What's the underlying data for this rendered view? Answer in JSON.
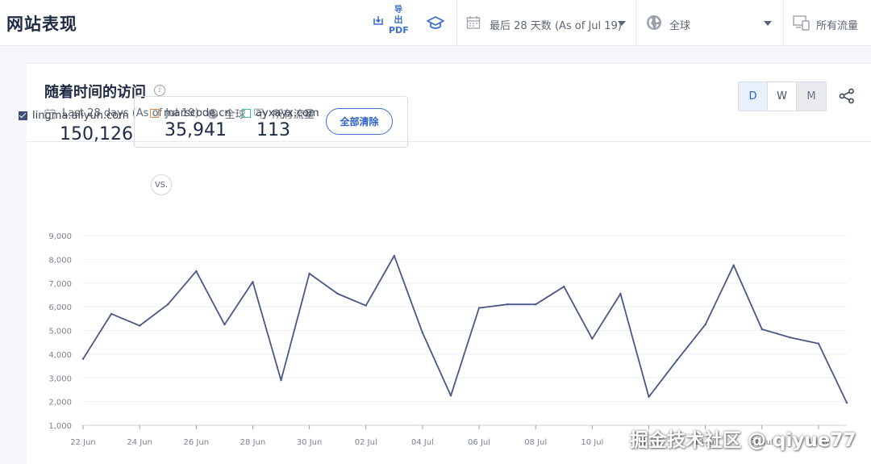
{
  "header": {
    "title": "网站表现",
    "export_label_1": "导",
    "export_label_2": "出",
    "export_label_3": "PDF",
    "date_range": "最后 28 天数 (As of Jul 19)",
    "region": "全球",
    "traffic": "所有流量"
  },
  "card": {
    "title": "随着时间的访问",
    "info": "i",
    "sub_date": "Last 28 days (As of Jul 19)",
    "sub_region": "全球",
    "sub_traffic": "所有流量",
    "granularity": [
      "D",
      "W",
      "M"
    ]
  },
  "metrics": {
    "primary": {
      "site": "lingma.aliyun.com",
      "value": "150,126"
    },
    "vs": "VS.",
    "compare": [
      {
        "site": "marscode.cn",
        "value": "35,941"
      },
      {
        "site": "ayxayx.com",
        "value": "113"
      }
    ],
    "clear_all": "全部清除"
  },
  "colors": {
    "accent": "#3b6fd6",
    "series": "#4a5785",
    "marscode": "#e8883a",
    "ayxayx": "#3cbfa0"
  },
  "watermark": "掘金技术社区 @ qiyue77",
  "chart_data": {
    "type": "line",
    "ylim": [
      1000,
      9000
    ],
    "yticks": [
      "1,000",
      "2,000",
      "3,000",
      "4,000",
      "5,000",
      "6,000",
      "7,000",
      "8,000",
      "9,000"
    ],
    "xticks": [
      "22 Jun",
      "24 Jun",
      "26 Jun",
      "28 Jun",
      "30 Jun",
      "02 Jul",
      "04 Jul",
      "06 Jul",
      "08 Jul",
      "10 Jul",
      "12 Jul",
      "14 Jul",
      "16 Jul",
      "18 Jul"
    ],
    "x": [
      "22 Jun",
      "23 Jun",
      "24 Jun",
      "25 Jun",
      "26 Jun",
      "27 Jun",
      "28 Jun",
      "29 Jun",
      "30 Jun",
      "01 Jul",
      "02 Jul",
      "03 Jul",
      "04 Jul",
      "05 Jul",
      "06 Jul",
      "07 Jul",
      "08 Jul",
      "09 Jul",
      "10 Jul",
      "11 Jul",
      "12 Jul",
      "13 Jul",
      "14 Jul",
      "15 Jul",
      "16 Jul",
      "17 Jul",
      "18 Jul",
      "19 Jul"
    ],
    "series": [
      {
        "name": "lingma.aliyun.com",
        "values": [
          3800,
          5700,
          5200,
          6100,
          7500,
          5250,
          7050,
          2900,
          7400,
          6550,
          6050,
          8150,
          4900,
          2250,
          5950,
          6100,
          6100,
          6850,
          4650,
          6550,
          2200,
          3750,
          5250,
          7750,
          5050,
          4700,
          4450,
          1950
        ]
      }
    ]
  }
}
